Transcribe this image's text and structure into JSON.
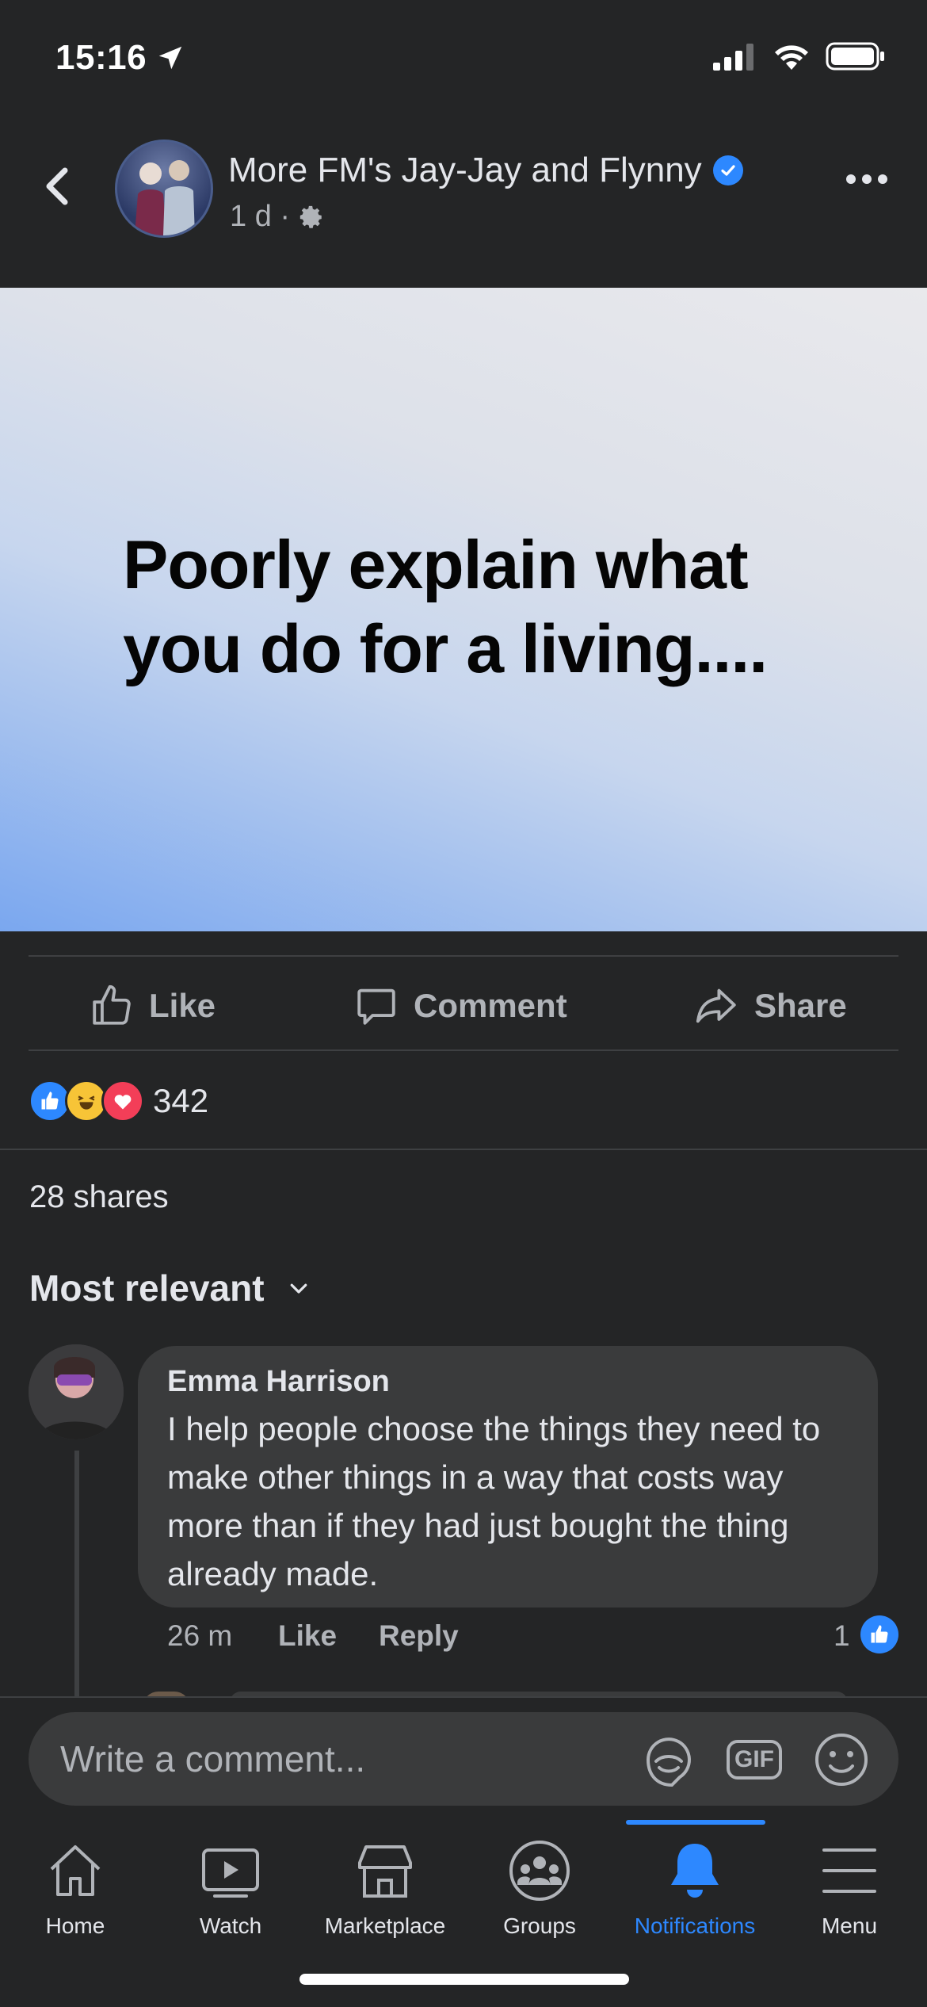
{
  "status_bar": {
    "time": "15:16"
  },
  "header": {
    "page_name": "More FM's Jay-Jay and Flynny",
    "meta": "1 d ·"
  },
  "post": {
    "text": "Poorly explain what you do for a living...."
  },
  "actions": {
    "like": "Like",
    "comment": "Comment",
    "share": "Share"
  },
  "reactions": {
    "count": "342"
  },
  "shares": "28 shares",
  "sort": {
    "label": "Most relevant"
  },
  "comment": {
    "author": "Emma Harrison",
    "text": "I help people choose the things they need to make other things in a way that costs way more than if they had just bought the thing already made.",
    "time": "26 m",
    "like": "Like",
    "reply": "Reply",
    "like_count": "1"
  },
  "composer": {
    "placeholder": "Write a comment...",
    "gif": "GIF"
  },
  "tabbar": {
    "items": [
      {
        "label": "Home"
      },
      {
        "label": "Watch"
      },
      {
        "label": "Marketplace"
      },
      {
        "label": "Groups"
      },
      {
        "label": "Notifications"
      },
      {
        "label": "Menu"
      }
    ],
    "active": "Notifications",
    "accent": "#2d88ff"
  }
}
